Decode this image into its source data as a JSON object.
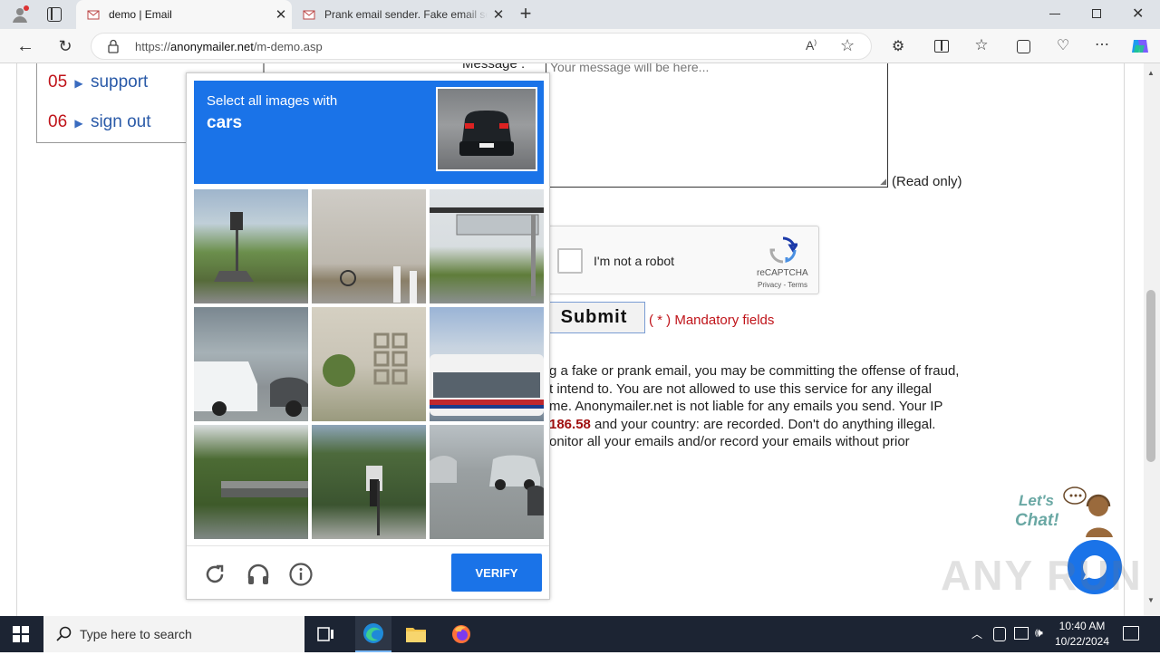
{
  "browser": {
    "tabs": [
      {
        "title": "demo | Email",
        "active": true
      },
      {
        "title": "Prank email sender. Fake email se",
        "active": false
      }
    ],
    "address": {
      "prefix": "https://",
      "domain": "anonymailer.net",
      "path": "/m-demo.asp"
    }
  },
  "nav": {
    "items": [
      {
        "num": "05",
        "label": "support"
      },
      {
        "num": "06",
        "label": "sign out"
      }
    ]
  },
  "form": {
    "message_label": "Message :",
    "message_placeholder": "Your message will be here...",
    "read_only": "(Read only)",
    "recaptcha_label": "I'm not a robot",
    "recaptcha_brand": "reCAPTCHA",
    "recaptcha_links": "Privacy - Terms",
    "submit": "Submit",
    "mandatory": "( * ) Mandatory fields"
  },
  "disclaimer": {
    "line1": "g a fake or prank email, you may be committing the offense of fraud,",
    "line2": "t intend to. You are not allowed to use this service for any illegal",
    "line3": "me. Anonymailer.net is not liable for any emails you send. Your IP",
    "ip": "186.58",
    "line4": " and your country: are recorded. Don't do anything illegal.",
    "line5": "onitor all your emails and/or record your emails without prior"
  },
  "captcha": {
    "prompt": "Select all images with",
    "object": "cars",
    "verify": "VERIFY"
  },
  "chat": {
    "text1": "Let's",
    "text2": "Chat!"
  },
  "watermark": "ANY RUN",
  "taskbar": {
    "search_placeholder": "Type here to search",
    "time": "10:40 AM",
    "date": "10/22/2024"
  }
}
